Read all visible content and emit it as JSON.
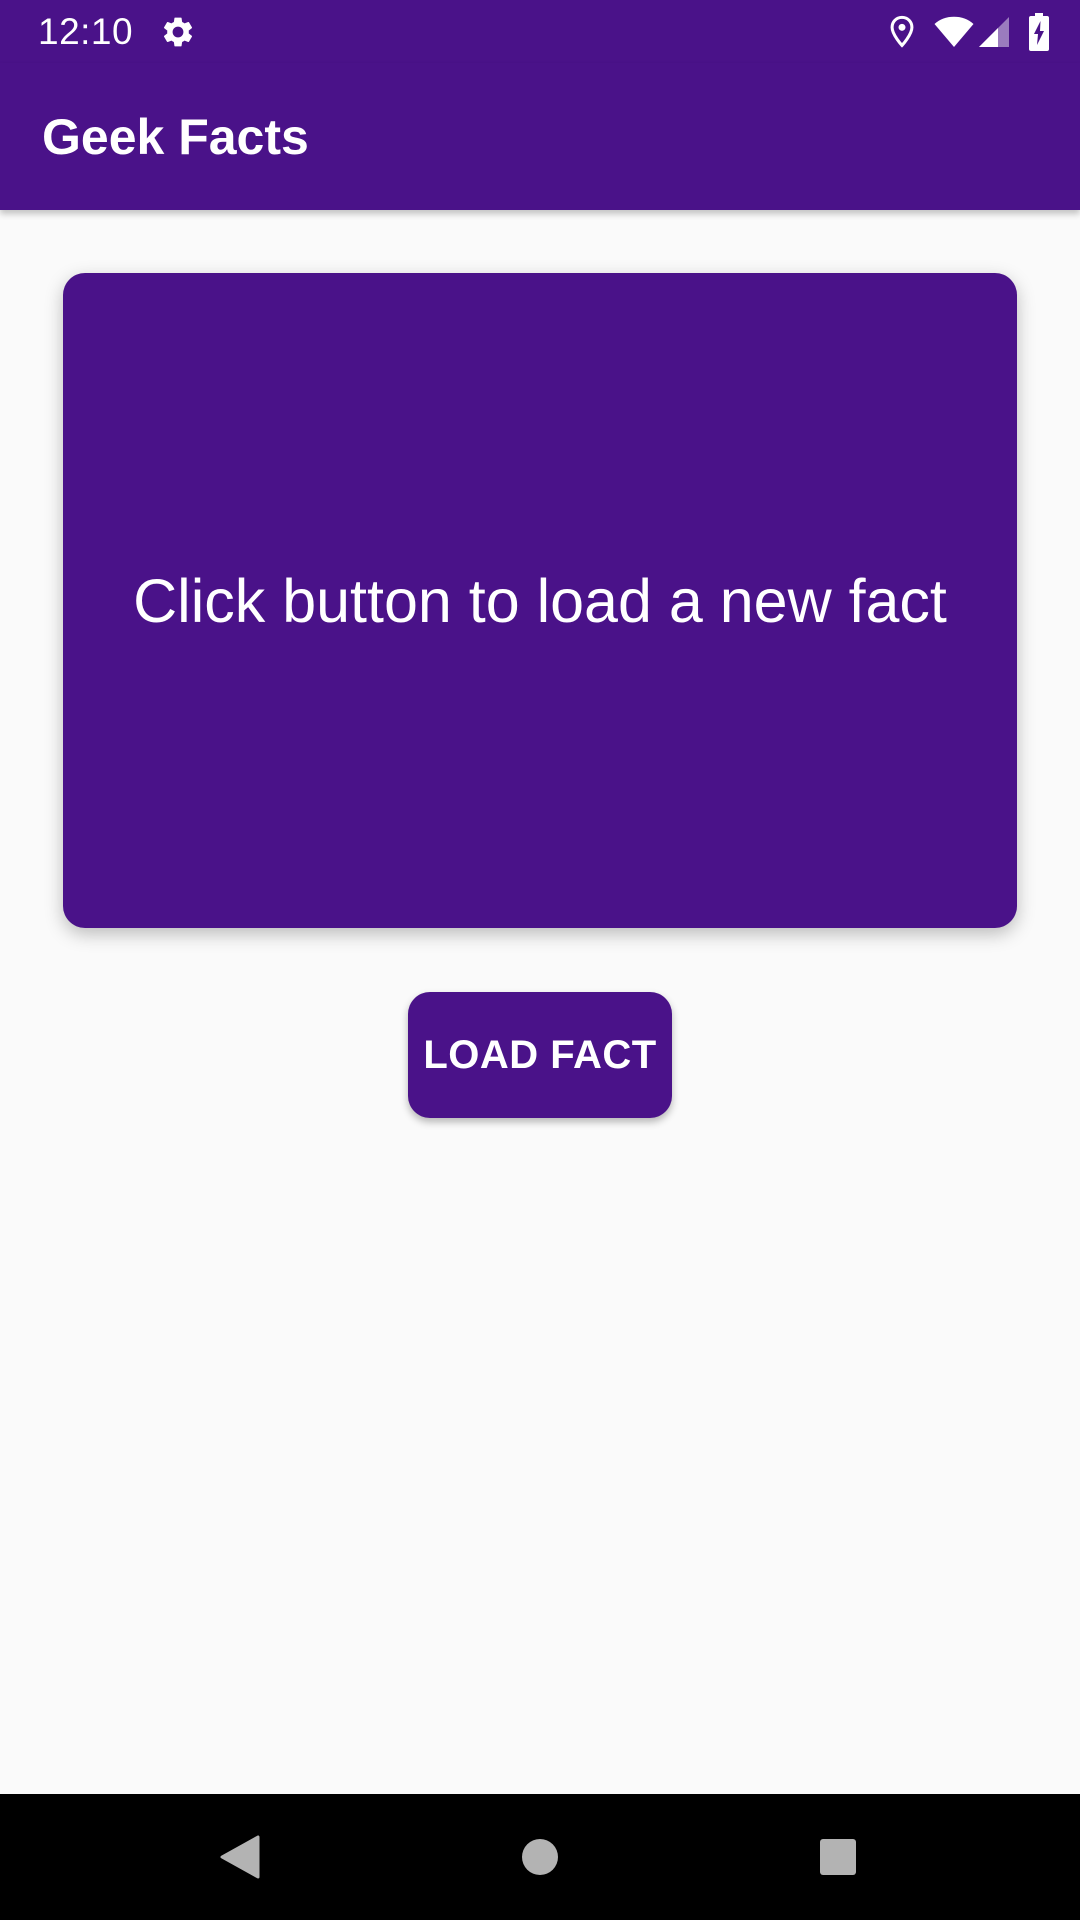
{
  "status_bar": {
    "time": "12:10",
    "icons": [
      "gear-icon",
      "location-icon",
      "wifi-icon",
      "signal-icon",
      "battery-charging-icon"
    ]
  },
  "app_bar": {
    "title": "Geek Facts"
  },
  "fact_card": {
    "text": "Click button to load a new fact"
  },
  "load_button": {
    "label": "LOAD FACT"
  },
  "nav_bar": {
    "icons": [
      "back-icon",
      "home-icon",
      "recents-icon"
    ]
  },
  "colors": {
    "primary": "#4a1289",
    "background": "#fafafa",
    "on_primary": "#ffffff",
    "nav_bar": "#000000"
  }
}
